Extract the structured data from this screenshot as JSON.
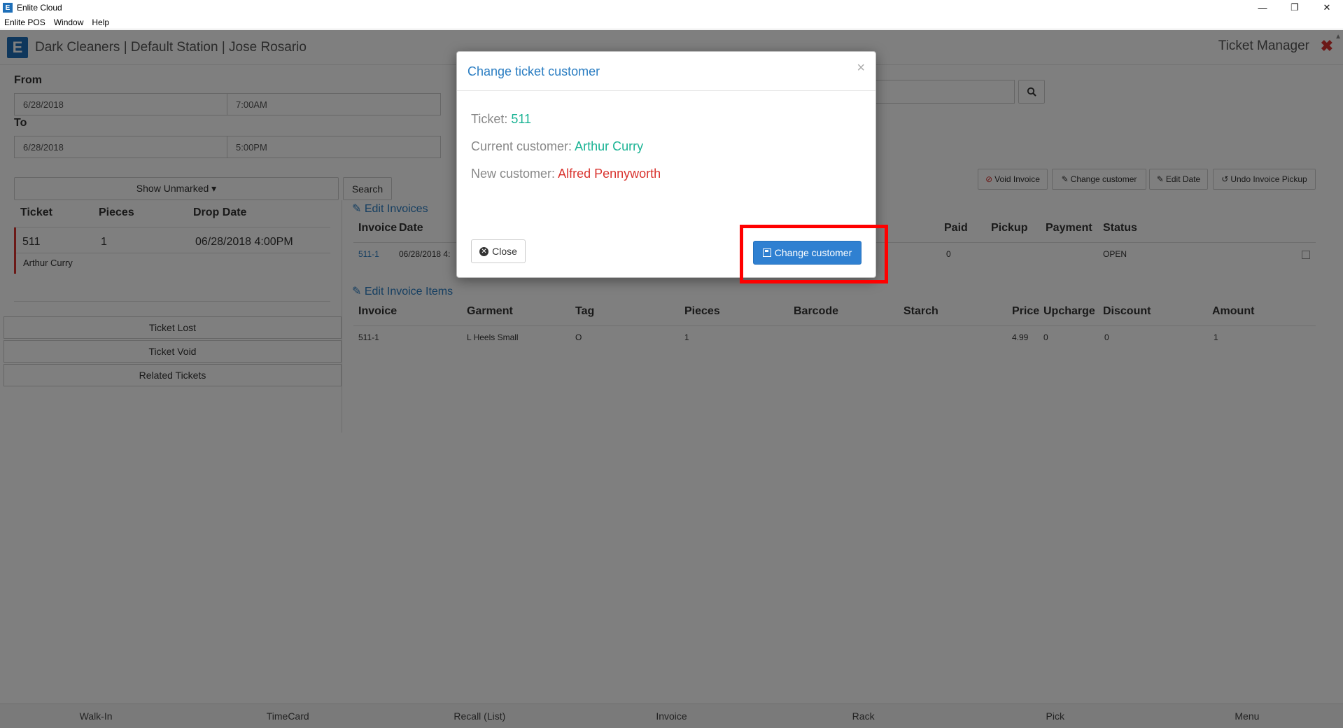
{
  "window": {
    "title": "Enlite Cloud",
    "logo_letter": "E",
    "minimize": "—",
    "restore": "❐",
    "close": "✕"
  },
  "menu": [
    "Enlite POS",
    "Window",
    "Help"
  ],
  "header": {
    "logo_letter": "E",
    "title": "Dark Cleaners | Default Station | Jose Rosario",
    "module": "Ticket Manager",
    "close_glyph": "✖"
  },
  "filters": {
    "from_label": "From",
    "from_date": "6/28/2018",
    "from_time": "7:00AM",
    "to_label": "To",
    "to_date": "6/28/2018",
    "to_time": "5:00PM",
    "show_unmarked": "Show Unmarked ▾",
    "search_button": "Search"
  },
  "tickets": {
    "columns": [
      "Ticket",
      "Pieces",
      "Drop Date"
    ],
    "rows": [
      {
        "ticket": "511",
        "pieces": "1",
        "drop_date": "06/28/2018 4:00PM",
        "customer": "Arthur Curry"
      }
    ]
  },
  "side_buttons": [
    "Ticket Lost",
    "Ticket Void",
    "Related Tickets"
  ],
  "actions": [
    "Void Invoice",
    "Change customer",
    "Edit Date",
    "Undo Invoice Pickup"
  ],
  "invoices": {
    "edit_link": "Edit Invoices",
    "columns": [
      "Invoice",
      "Date",
      "Paid",
      "Pickup",
      "Payment",
      "Status"
    ],
    "rows": [
      {
        "invoice": "511-1",
        "date": "06/28/2018 4:",
        "paid": "0",
        "pickup": "",
        "payment": "",
        "status": "OPEN"
      }
    ]
  },
  "invoice_items": {
    "edit_link": "Edit Invoice Items",
    "columns": [
      "Invoice",
      "Garment",
      "Tag",
      "Pieces",
      "Barcode",
      "Starch",
      "Price",
      "Upcharge",
      "Discount",
      "Amount"
    ],
    "rows": [
      {
        "invoice": "511-1",
        "garment": "L Heels Small",
        "tag": "O",
        "pieces": "1",
        "barcode": "",
        "starch": "",
        "price": "4.99",
        "upcharge": "0",
        "discount": "0",
        "amount": "1"
      }
    ]
  },
  "modal": {
    "title": "Change ticket customer",
    "close_glyph": "×",
    "ticket_label": "Ticket:",
    "ticket_value": "511",
    "current_label": "Current customer:",
    "current_value": "Arthur Curry",
    "new_label": "New customer:",
    "new_value": "Alfred Pennyworth",
    "close_button": "Close",
    "primary_button": "Change customer"
  },
  "bottom_tabs": [
    "Walk-In",
    "TimeCard",
    "Recall (List)",
    "Invoice",
    "Rack",
    "Pick",
    "Menu"
  ],
  "colors": {
    "accent": "#2a7dc2",
    "primary_button": "#2f80d1",
    "green": "#1ab394",
    "red": "#d9332e",
    "highlight": "#ff0000"
  }
}
